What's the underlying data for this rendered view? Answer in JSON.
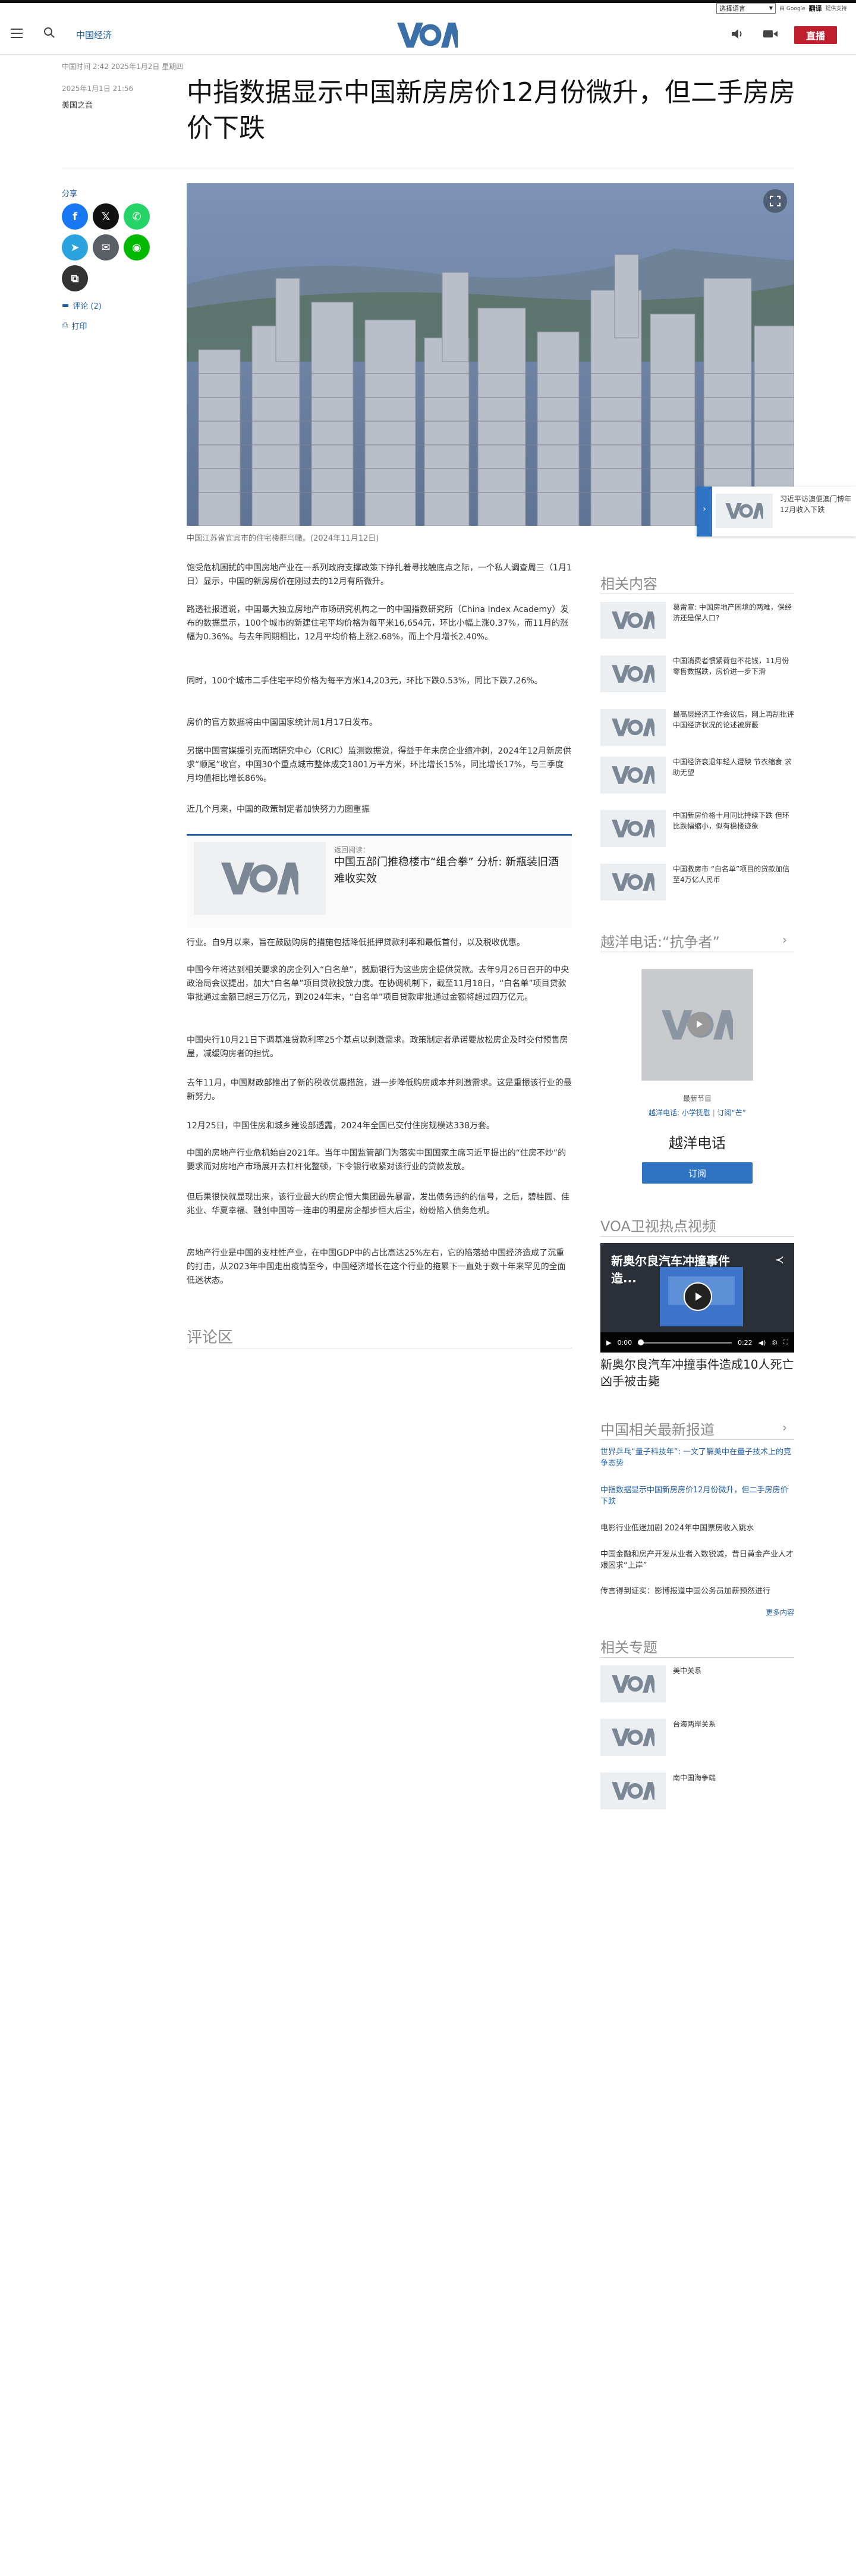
{
  "translate": {
    "select_label": "选择语言",
    "powered": "由 Google",
    "brand": "翻译",
    "suffix": "提供支持"
  },
  "header": {
    "section": "中国经济",
    "live_label": "直播"
  },
  "article": {
    "datetime": "中国时间 2:42 2025年1月2日 星期四",
    "pubdate": "2025年1月1日 21:56",
    "author": "美国之音",
    "title": "中指数据显示中国新房房价12月份微升，但二手房房价下跌",
    "caption": "中国江苏省宜宾市的住宅楼群鸟瞰。(2024年11月12日)",
    "share_label": "分享",
    "comment_link": "评论 (2)",
    "print_link": "打印",
    "paragraphs": [
      "饱受危机困扰的中国房地产业在一系列政府支撑政策下挣扎着寻找触底点之际，一个私人调查周三（1月1日）显示，中国的新房房价在刚过去的12月有所微升。",
      "路透社报道说，中国最大独立房地产市场研究机构之一的中国指数研究所（China Index Academy）发布的数据显示，100个城市的新建住宅平均价格为每平米16,654元，环比小幅上涨0.37%，而11月的涨幅为0.36%。与去年同期相比，12月平均价格上涨2.68%，而上个月增长2.40%。",
      "同时，100个城市二手住宅平均价格为每平方米14,203元，环比下跌0.53%，同比下跌7.26%。",
      "房价的官方数据将由中国国家统计局1月17日发布。",
      "另据中国官媒援引克而瑞研究中心（CRIC）监测数据说，得益于年末房企业绩冲刺，2024年12月新房供求“顺尾”收官，中国30个重点城市整体成交1801万平方米，环比增长15%，同比增长17%，与三季度月均值相比增长86%。",
      "近几个月来，中国的政策制定者加快努力力图重振"
    ],
    "paragraphs2": [
      "行业。自9月以来，旨在鼓励购房的措施包括降低抵押贷款利率和最低首付，以及税收优惠。",
      "中国今年将达到相关要求的房企列入“白名单”，鼓励银行为这些房企提供贷款。去年9月26日召开的中央政治局会议提出，加大“白名单”项目贷款投放力度。在协调机制下，截至11月18日，“白名单”项目贷款审批通过金额已超三万亿元，到2024年末，“白名单”项目贷款审批通过金额将超过四万亿元。",
      "中国央行10月21日下调基准贷款利率25个基点以刺激需求。政策制定者承诺要放松房企及时交付预售房屋，减缓购房者的担忧。",
      "去年11月，中国财政部推出了新的税收优惠措施，进一步降低购房成本并刺激需求。这是重振该行业的最新努力。",
      "12月25日，中国住房和城乡建设部透露，2024年全国已交付住房规模达338万套。",
      "中国的房地产行业危机始自2021年。当年中国监管部门为落实中国国家主席习近平提出的“住房不炒”的要求而对房地产市场展开去杠杆化整顿，下令银行收紧对该行业的贷款发放。",
      "但后果很快就显现出来，该行业最大的房企恒大集团最先暴雷，发出债务违约的信号，之后，碧桂园、佳兆业、华夏幸福、融创中国等一连串的明星房企都步恒大后尘，纷纷陷入债务危机。",
      "房地产行业是中国的支柱性产业，在中国GDP中的占比高达25%左右，它的陷落给中国经济造成了沉重的打击，从2023年中国走出疫情至今，中国经济增长在这个行业的拖累下一直处于数十年来罕见的全面低迷状态。"
    ],
    "related_box": {
      "label": "返回阅读：",
      "title": "中国五部门推稳楼市“组合拳” 分析: 新瓶装旧酒难收实效"
    },
    "comments_title": "评论区"
  },
  "popup": {
    "text": "习近平访澳便澳门博年12月收入下跌"
  },
  "sidebar": {
    "related_title": "相关内容",
    "related": [
      "葛雷宣: 中国房地产困境的两难，保经济还是保人口?",
      "中国消费者惯紧荷包不花钱，11月份零售数据跌，房价进一步下滑",
      "最高层经济工作会议后，网上再刮批评中国经济状况的论述被屏蔽",
      "中国经济衰退年轻人遭殃 节衣缩食 求助无望",
      "中国新房价格十月同比持续下跌 但环比跌幅缩小，似有稳楼迹象",
      "中国救房市 “白名单”项目的贷款加信至4万亿人民币"
    ],
    "radio_title": "越洋电话:“抗争者”",
    "radio_sub": "最新节目",
    "radio_links": [
      "越洋电话: 小学抚慰",
      "订阅“芒”"
    ],
    "radio_name": "越洋电话",
    "subscribe_label": "订阅",
    "video_title_section": "VOA卫视热点视频",
    "video_overlay": "新奥尔良汽车冲撞事件造...",
    "video_time": "0:00",
    "video_duration": "0:22",
    "video_caption": "新奥尔良汽车冲撞事件造成10人死亡凶手被击毙",
    "news_title": "中国相关最新报道",
    "news": [
      "世界乒乓“量子科技年”: 一文了解美中在量子技术上的竞争态势",
      "中指数据显示中国新房房价12月份微升，但二手房房价下跌",
      "电影行业低迷加剧 2024年中国票房收入跳水",
      "中国金融和房产开发从业者入数锐减，昔日黄金产业人才艰困求“上岸”",
      "传言得到证实：影博报道中国公务员加薪预然进行"
    ],
    "more_label": "更多内容",
    "topics_title": "相关专题",
    "topics": [
      "美中关系",
      "台海两岸关系",
      "南中国海争端"
    ]
  },
  "colors": {
    "brand_blue": "#1f5da6",
    "live_red": "#be1e2d",
    "accent_blue": "#2e74c3"
  },
  "icons": [
    "menu-icon",
    "search-icon",
    "voa-logo",
    "speaker-icon",
    "video-camera-icon",
    "facebook-icon",
    "x-icon",
    "whatsapp-icon",
    "telegram-icon",
    "email-icon",
    "line-icon",
    "copy-link-icon",
    "comment-icon",
    "print-icon",
    "expand-icon",
    "play-icon",
    "chevron-right-icon"
  ]
}
